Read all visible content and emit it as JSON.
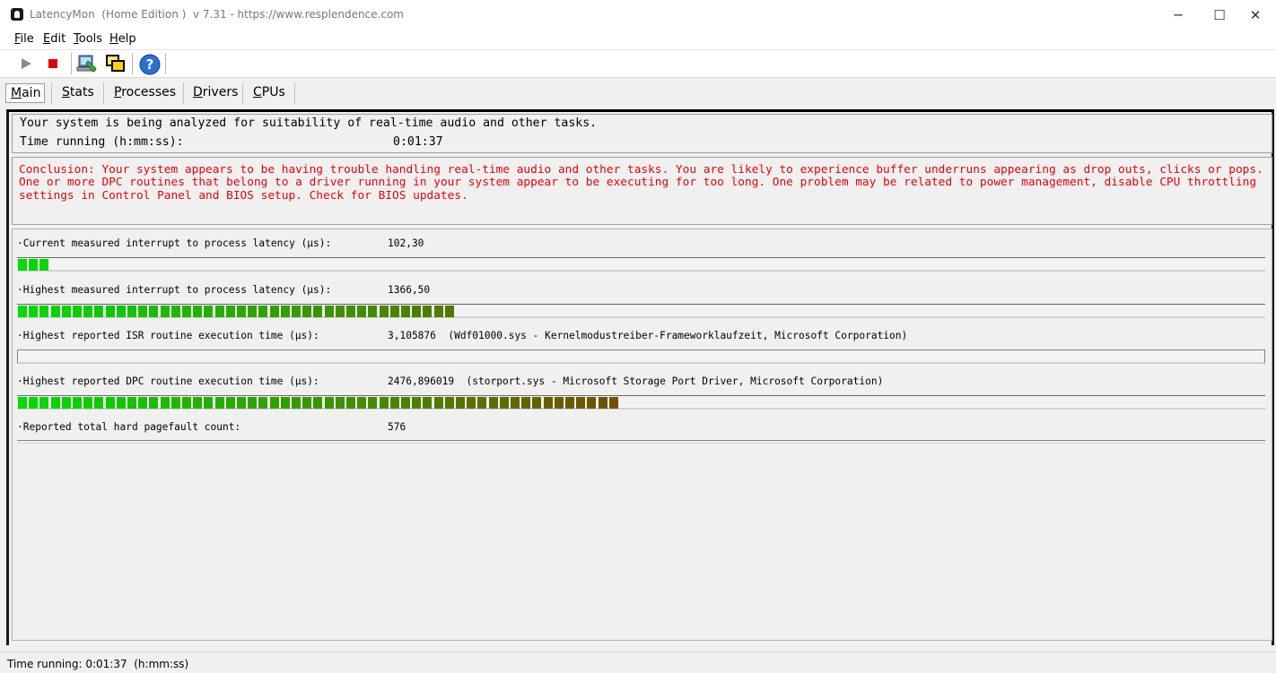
{
  "window": {
    "title": "LatencyMon  (Home Edition )  v 7.31 - https://www.resplendence.com",
    "minimize_glyph": "─",
    "maximize_glyph": "☐",
    "close_glyph": "✕"
  },
  "menu": [
    {
      "first": "F",
      "rest": "ile"
    },
    {
      "first": "E",
      "rest": "dit"
    },
    {
      "first": "T",
      "rest": "ools"
    },
    {
      "first": "H",
      "rest": "elp"
    }
  ],
  "toolbar": {
    "icons": [
      "play-icon",
      "stop-icon",
      "computer-settings-icon",
      "windows-icon",
      "help-icon"
    ],
    "help_glyph": "?"
  },
  "tabs": [
    {
      "first": "M",
      "rest": "ain"
    },
    {
      "first": "S",
      "rest": "tats"
    },
    {
      "first": "P",
      "rest": "rocesses"
    },
    {
      "first": "D",
      "rest": "rivers"
    },
    {
      "first": "C",
      "rest": "PUs"
    }
  ],
  "status": {
    "analyzing_text": "Your system is being analyzed for suitability of real-time audio and other tasks.",
    "time_running_label": "Time running (h:mm:ss):",
    "time_running_value": "0:01:37"
  },
  "conclusion": "Conclusion: Your system appears to be having trouble handling real-time audio and other tasks. You are likely to experience buffer underruns appearing as drop outs, clicks or pops. One or more DPC routines that belong to a driver running in your system appear to be executing for too long. One problem may be related to power management, disable CPU throttling settings in Control Panel and BIOS setup. Check for BIOS updates.",
  "metrics": [
    {
      "label": "·Current measured interrupt to process latency (µs):",
      "value": "102,30",
      "bar_segments": 3
    },
    {
      "label": "·Highest measured interrupt to process latency (µs):",
      "value": "1366,50",
      "bar_segments": 40
    },
    {
      "label": "·Highest reported ISR routine execution time (µs):",
      "value": "3,105876  (Wdf01000.sys - Kernelmodustreiber-Frameworklaufzeit, Microsoft Corporation)",
      "bar_segments": 0
    },
    {
      "label": "·Highest reported DPC routine execution time (µs):",
      "value": "2476,896019  (storport.sys - Microsoft Storage Port Driver, Microsoft Corporation)",
      "bar_segments": 55
    },
    {
      "label": "·Reported total hard pagefault count:",
      "value": "576"
    }
  ],
  "statusbar": {
    "text": "Time running: 0:01:37  (h:mm:ss)"
  }
}
